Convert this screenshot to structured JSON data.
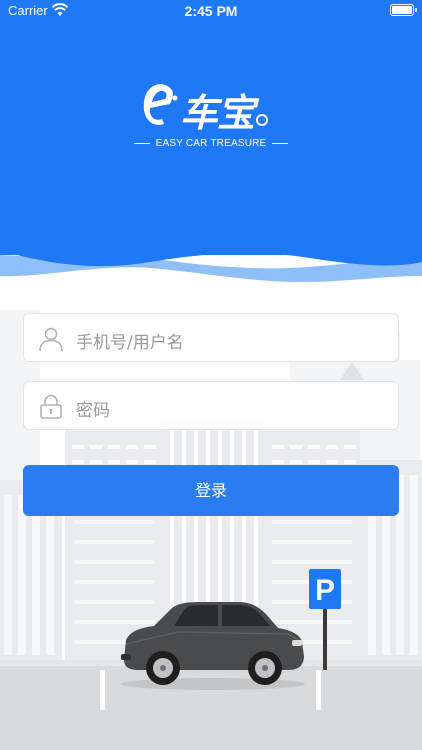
{
  "status_bar": {
    "carrier": "Carrier",
    "time": "2:45 PM"
  },
  "brand": {
    "logo_letter": "e",
    "logo_chinese": "车宝",
    "tagline": "EASY CAR TREASURE",
    "primary_color": "#1f78f5",
    "wave_light_color": "#8ebff9"
  },
  "login_form": {
    "username_placeholder": "手机号/用户名",
    "password_placeholder": "密码",
    "submit_label": "登录"
  },
  "parking": {
    "sign_letter": "P"
  }
}
